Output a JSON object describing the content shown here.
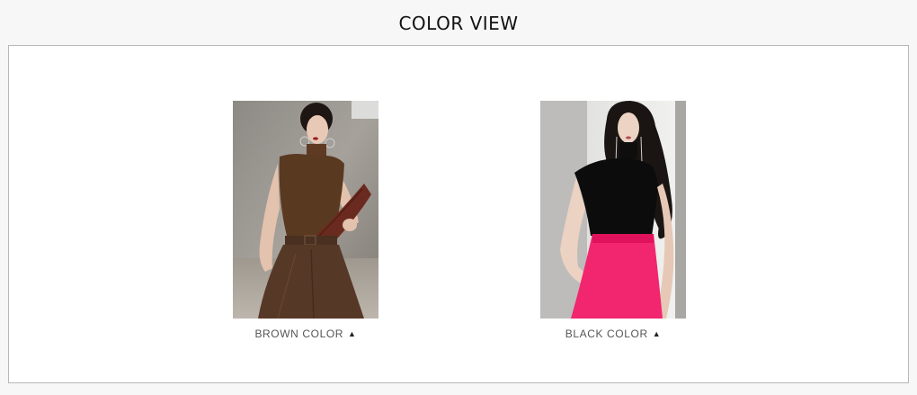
{
  "page_title": "COLOR VIEW",
  "colors": [
    {
      "label": "BROWN COLOR",
      "arrow_icon": "▲",
      "icon_name": "triangle-up-icon",
      "swatch": "#5b3a26"
    },
    {
      "label": "BLACK COLOR",
      "arrow_icon": "▲",
      "icon_name": "triangle-up-icon",
      "swatch": "#111111"
    }
  ],
  "accent_colors": {
    "skirt_pink": "#f2256f",
    "pants_brown": "#5a3b28",
    "background_gray": "#9a948d"
  }
}
